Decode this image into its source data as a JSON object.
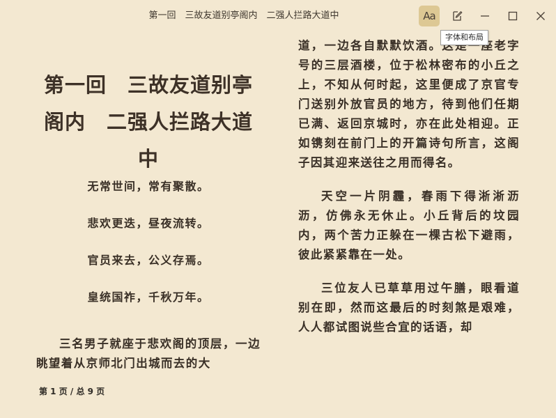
{
  "window": {
    "title": "第一回　三故友道别亭阁内　二强人拦路大道中"
  },
  "toolbar": {
    "font_button_label": "Aa",
    "tooltip": "字体和布局",
    "icons": [
      "font-layout-icon",
      "edit-icon",
      "minimize-icon",
      "maximize-icon",
      "close-icon"
    ]
  },
  "page_left": {
    "chapter_title": "第一回　三故友道别亭阁内　二强人拦路大道中",
    "poem": [
      "无常世间，常有聚散。",
      "悲欢更迭，昼夜流转。",
      "官员来去，公义存焉。",
      "皇统国祚，千秋万年。"
    ],
    "paragraph_start": "三名男子就座于悲欢阁的顶层，一边眺望着从京师北门出城而去的大"
  },
  "page_right": {
    "paragraphs": [
      "道，一边各自默默饮酒。这是一座老字号的三层酒楼，位于松林密布的小丘之上，不知从何时起，这里便成了京官专门送别外放官员的地方，待到他们任期已满、返回京城时，亦在此处相迎。正如镌刻在前门上的开篇诗句所言，这阁子因其迎来送往之用而得名。",
      "天空一片阴霾，春雨下得淅淅沥沥，仿佛永无休止。小丘背后的坟园内，两个苦力正躲在一棵古松下避雨，彼此紧紧靠在一处。",
      "三位友人已草草用过午膳，眼看道别在即，然而这最后的时刻煞是艰难，人人都试图说些合宜的话语，却"
    ]
  },
  "footer": {
    "page_indicator": "第 1 页 / 总 9 页"
  },
  "colors": {
    "background": "#f3e8d1",
    "text": "#3a3027",
    "active_button": "#ddc894"
  }
}
